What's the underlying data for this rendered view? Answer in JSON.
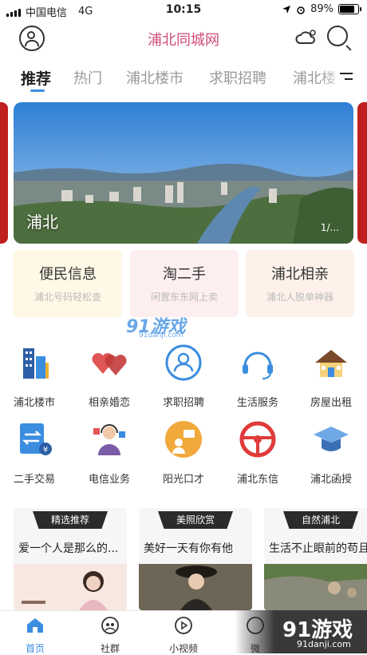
{
  "status": {
    "carrier": "中国电信",
    "network": "4G",
    "time": "10:15",
    "battery": "89%",
    "battery_level": 0.89
  },
  "header": {
    "title": "浦北同城网",
    "icons": [
      "user-icon",
      "weather-icon",
      "search-icon"
    ]
  },
  "tabs": [
    "推荐",
    "热门",
    "浦北楼市",
    "求职招聘",
    "浦北楼"
  ],
  "banner": {
    "label": "浦北",
    "pager": "1/..."
  },
  "cards": [
    {
      "title": "便民信息",
      "subtitle": "浦北号码轻松查"
    },
    {
      "title": "淘二手",
      "subtitle": "闲置东东网上卖"
    },
    {
      "title": "浦北相亲",
      "subtitle": "浦北人脱单神器"
    }
  ],
  "watermark": {
    "text": "91游戏",
    "url": "91danji.com"
  },
  "grid": [
    {
      "label": "浦北楼市",
      "icon": "building-icon"
    },
    {
      "label": "相亲婚恋",
      "icon": "hearts-icon"
    },
    {
      "label": "求职招聘",
      "icon": "job-icon"
    },
    {
      "label": "生活服务",
      "icon": "headset-icon"
    },
    {
      "label": "房屋出租",
      "icon": "house-icon"
    },
    {
      "label": "二手交易",
      "icon": "exchange-icon"
    },
    {
      "label": "电信业务",
      "icon": "telecom-icon"
    },
    {
      "label": "阳光口才",
      "icon": "speech-icon"
    },
    {
      "label": "浦北东信",
      "icon": "steering-wheel-icon"
    },
    {
      "label": "浦北函授",
      "icon": "graduation-cap-icon"
    }
  ],
  "feed": [
    {
      "tag": "精选推荐",
      "title": "爱一个人是那么的..."
    },
    {
      "tag": "美照欣赏",
      "title": "美好一天有你有他"
    },
    {
      "tag": "自然浦北",
      "title": "生活不止眼前的苟且"
    }
  ],
  "tabbar": [
    {
      "label": "首页",
      "icon": "home-icon"
    },
    {
      "label": "社群",
      "icon": "community-icon"
    },
    {
      "label": "小视频",
      "icon": "play-icon"
    },
    {
      "label": "微",
      "icon": "chat-icon"
    }
  ],
  "brand": {
    "logo": "91游戏",
    "url": "91danji.com"
  },
  "colors": {
    "accent": "#3b8de0",
    "title": "#d04b7a"
  }
}
